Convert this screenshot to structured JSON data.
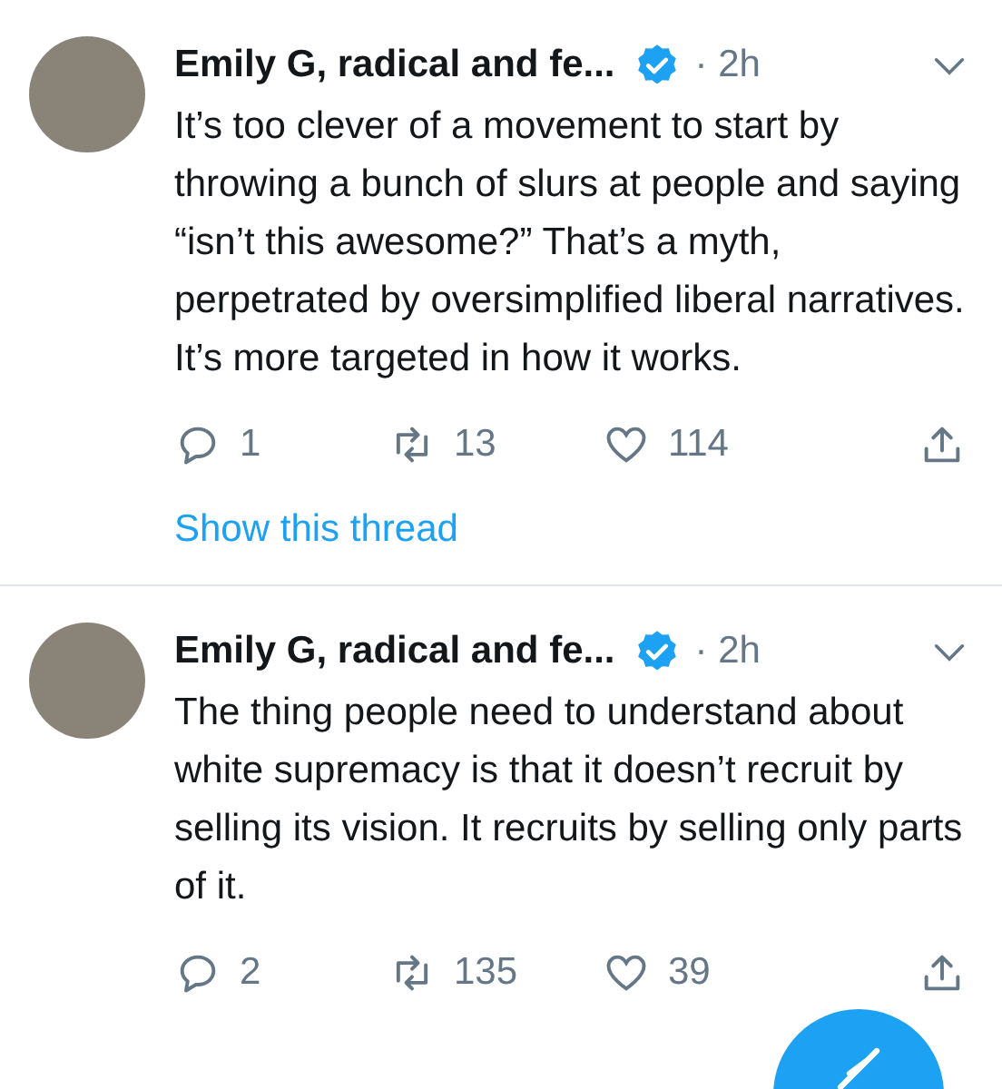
{
  "tweets": [
    {
      "author": "Emily G, radical and fe...",
      "verified": true,
      "time": "· 2h",
      "text": "It’s too clever of a movement to start by throwing a bunch of slurs at people and saying “isn’t this awesome?” That’s a myth, perpetrated by oversimplified liberal narratives. It’s more targeted in how it works.",
      "replies": "1",
      "retweets": "13",
      "likes": "114",
      "thread_link": "Show this thread"
    },
    {
      "author": "Emily G, radical and fe...",
      "verified": true,
      "time": "· 2h",
      "text": "The thing people need to understand about white supremacy is that it doesn’t recruit by selling its vision. It recruits by selling only parts of it.",
      "replies": "2",
      "retweets": "135",
      "likes": "39"
    }
  ]
}
